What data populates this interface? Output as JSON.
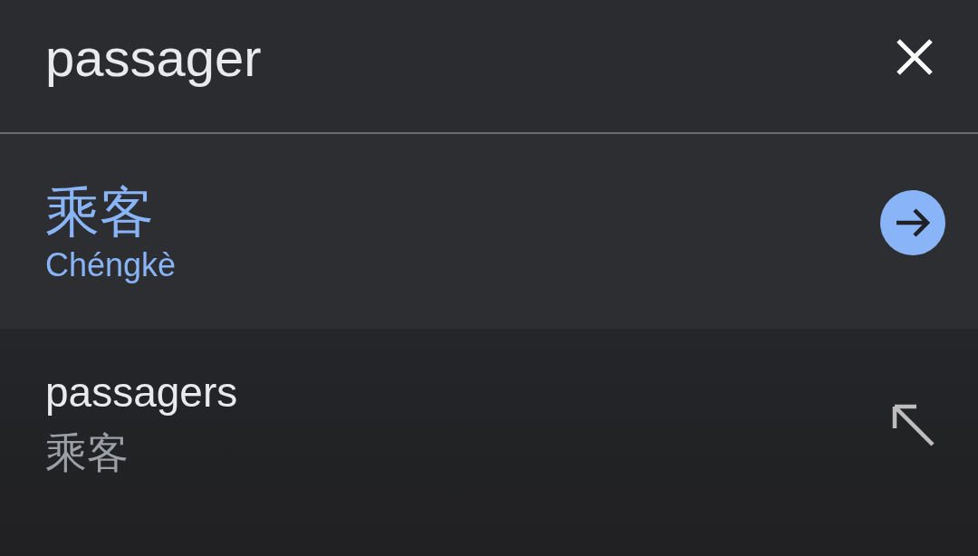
{
  "search": {
    "value": "passager"
  },
  "translation": {
    "text": "乘客",
    "romanization": "Chéngkè"
  },
  "suggestions": [
    {
      "text": "passagers",
      "translation": "乘客"
    }
  ]
}
